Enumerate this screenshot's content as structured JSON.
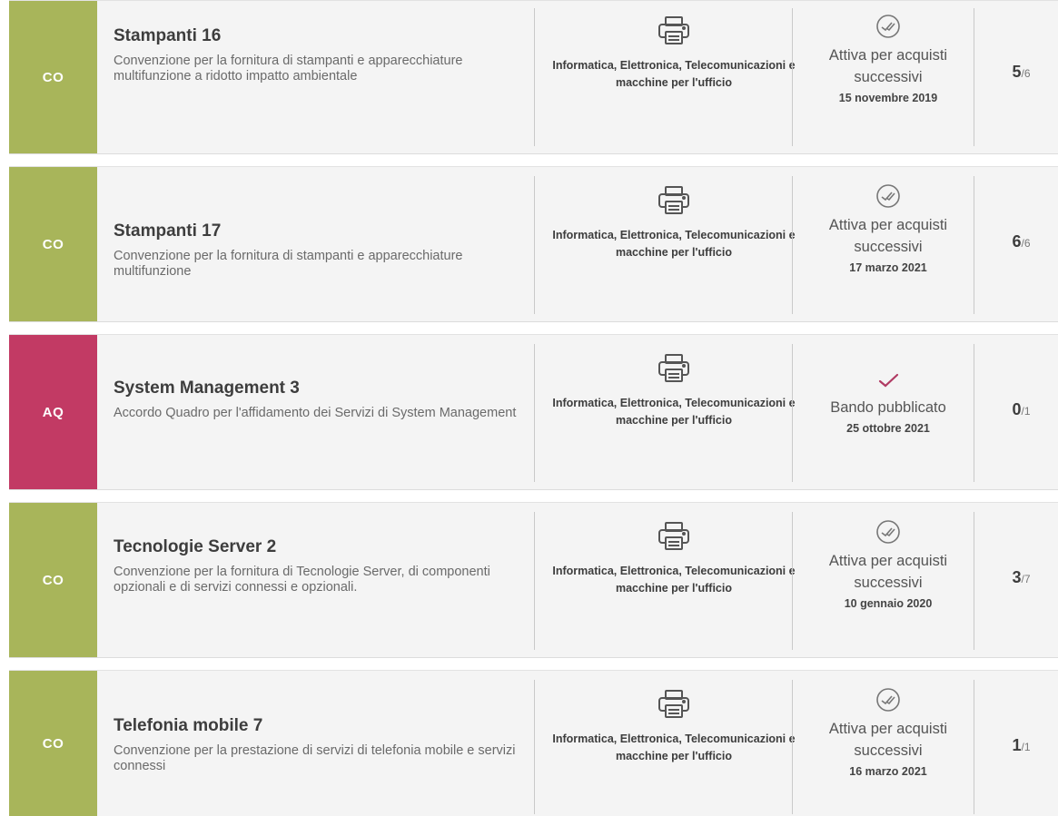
{
  "colors": {
    "co": "#a8b55a",
    "aq": "#c23a64",
    "card_bg": "#f4f4f4"
  },
  "items": [
    {
      "badge": "CO",
      "title": "Stampanti 16",
      "description": "Convenzione per la fornitura di stampanti e apparecchiature multifunzione a ridotto impatto ambientale",
      "category_icon": "printer-icon",
      "category": "Informatica, Elettronica, Telecomunicazioni e macchine per l'ufficio",
      "status_icon": "double-check-circle-icon",
      "status": "Attiva per acquisti successivi",
      "date": "15 novembre 2019",
      "count_num": "5",
      "count_total": "/6"
    },
    {
      "badge": "CO",
      "title": "Stampanti 17",
      "description": "Convenzione per la fornitura di stampanti e apparecchiature multifunzione",
      "category_icon": "printer-icon",
      "category": "Informatica, Elettronica, Telecomunicazioni e macchine per l'ufficio",
      "status_icon": "double-check-circle-icon",
      "status": "Attiva per acquisti successivi",
      "date": "17 marzo 2021",
      "count_num": "6",
      "count_total": "/6"
    },
    {
      "badge": "AQ",
      "title": "System Management 3",
      "description": "Accordo Quadro per l'affidamento dei Servizi di System Management",
      "category_icon": "printer-icon",
      "category": "Informatica, Elettronica, Telecomunicazioni e macchine per l'ufficio",
      "status_icon": "check-icon",
      "status": "Bando pubblicato",
      "date": "25 ottobre 2021",
      "count_num": "0",
      "count_total": "/1"
    },
    {
      "badge": "CO",
      "title": "Tecnologie Server 2",
      "description": "Convenzione per la fornitura di Tecnologie Server, di componenti opzionali e di servizi connessi e opzionali.",
      "category_icon": "printer-icon",
      "category": "Informatica, Elettronica, Telecomunicazioni e macchine per l'ufficio",
      "status_icon": "double-check-circle-icon",
      "status": "Attiva per acquisti successivi",
      "date": "10 gennaio 2020",
      "count_num": "3",
      "count_total": "/7"
    },
    {
      "badge": "CO",
      "title": "Telefonia mobile 7",
      "description": "Convenzione per la prestazione di servizi di telefonia mobile e servizi connessi",
      "category_icon": "printer-icon",
      "category": "Informatica, Elettronica, Telecomunicazioni e macchine per l'ufficio",
      "status_icon": "double-check-circle-icon",
      "status": "Attiva per acquisti successivi",
      "date": "16 marzo 2021",
      "count_num": "1",
      "count_total": "/1"
    }
  ]
}
